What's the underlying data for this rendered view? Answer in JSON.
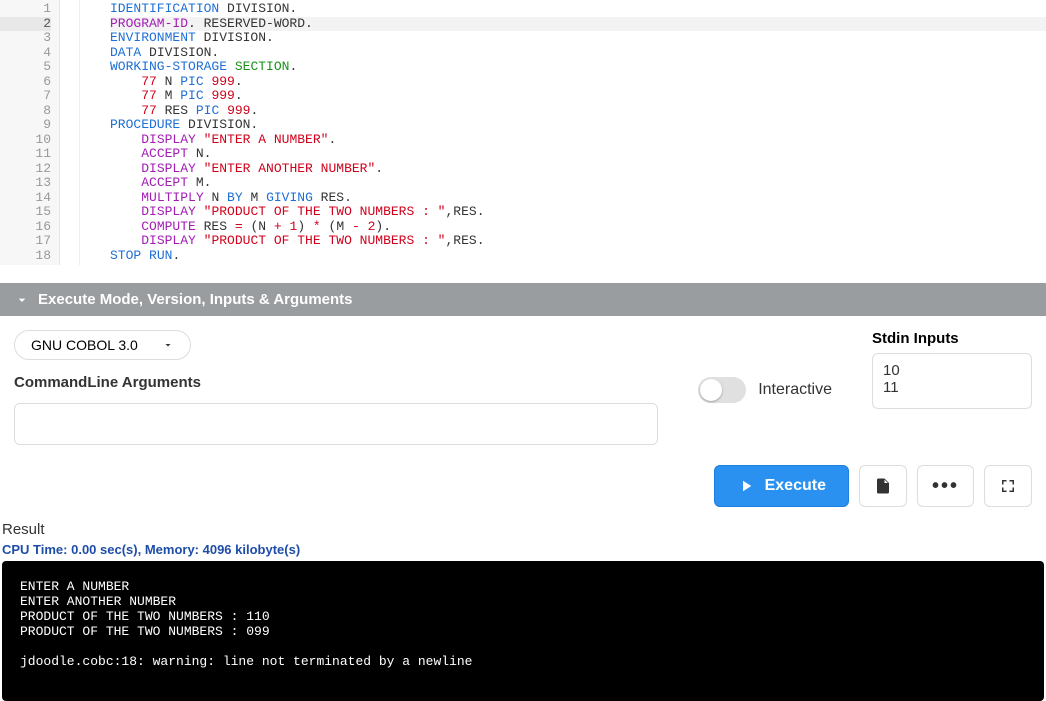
{
  "editor": {
    "active_line": 2,
    "line_count": 18,
    "tokens": [
      [
        {
          "t": "IDENTIFICATION",
          "c": "kw-blue"
        },
        {
          "t": " DIVISION.",
          "c": "plain"
        }
      ],
      [
        {
          "t": "PROGRAM-ID",
          "c": "kw-purple"
        },
        {
          "t": ". RESERVED-WORD.",
          "c": "plain"
        }
      ],
      [
        {
          "t": "ENVIRONMENT",
          "c": "kw-blue"
        },
        {
          "t": " DIVISION.",
          "c": "plain"
        }
      ],
      [
        {
          "t": "DATA",
          "c": "kw-blue"
        },
        {
          "t": " DIVISION.",
          "c": "plain"
        }
      ],
      [
        {
          "t": "WORKING-STORAGE",
          "c": "kw-blue"
        },
        {
          "t": " ",
          "c": "plain"
        },
        {
          "t": "SECTION",
          "c": "kw-green"
        },
        {
          "t": ".",
          "c": "plain"
        }
      ],
      [
        {
          "t": "    ",
          "c": "plain"
        },
        {
          "t": "77",
          "c": "num-red"
        },
        {
          "t": " N ",
          "c": "plain"
        },
        {
          "t": "PIC",
          "c": "kw-blue"
        },
        {
          "t": " ",
          "c": "plain"
        },
        {
          "t": "999",
          "c": "num-red"
        },
        {
          "t": ".",
          "c": "plain"
        }
      ],
      [
        {
          "t": "    ",
          "c": "plain"
        },
        {
          "t": "77",
          "c": "num-red"
        },
        {
          "t": " M ",
          "c": "plain"
        },
        {
          "t": "PIC",
          "c": "kw-blue"
        },
        {
          "t": " ",
          "c": "plain"
        },
        {
          "t": "999",
          "c": "num-red"
        },
        {
          "t": ".",
          "c": "plain"
        }
      ],
      [
        {
          "t": "    ",
          "c": "plain"
        },
        {
          "t": "77",
          "c": "num-red"
        },
        {
          "t": " RES ",
          "c": "plain"
        },
        {
          "t": "PIC",
          "c": "kw-blue"
        },
        {
          "t": " ",
          "c": "plain"
        },
        {
          "t": "999",
          "c": "num-red"
        },
        {
          "t": ".",
          "c": "plain"
        }
      ],
      [
        {
          "t": "PROCEDURE",
          "c": "kw-blue"
        },
        {
          "t": " DIVISION.",
          "c": "plain"
        }
      ],
      [
        {
          "t": "    ",
          "c": "plain"
        },
        {
          "t": "DISPLAY",
          "c": "kw-purple"
        },
        {
          "t": " ",
          "c": "plain"
        },
        {
          "t": "\"ENTER A NUMBER\"",
          "c": "str-red"
        },
        {
          "t": ".",
          "c": "plain"
        }
      ],
      [
        {
          "t": "    ",
          "c": "plain"
        },
        {
          "t": "ACCEPT",
          "c": "kw-purple"
        },
        {
          "t": " N.",
          "c": "plain"
        }
      ],
      [
        {
          "t": "    ",
          "c": "plain"
        },
        {
          "t": "DISPLAY",
          "c": "kw-purple"
        },
        {
          "t": " ",
          "c": "plain"
        },
        {
          "t": "\"ENTER ANOTHER NUMBER\"",
          "c": "str-red"
        },
        {
          "t": ".",
          "c": "plain"
        }
      ],
      [
        {
          "t": "    ",
          "c": "plain"
        },
        {
          "t": "ACCEPT",
          "c": "kw-purple"
        },
        {
          "t": " M.",
          "c": "plain"
        }
      ],
      [
        {
          "t": "    ",
          "c": "plain"
        },
        {
          "t": "MULTIPLY",
          "c": "kw-purple"
        },
        {
          "t": " N ",
          "c": "plain"
        },
        {
          "t": "BY",
          "c": "kw-blue"
        },
        {
          "t": " M ",
          "c": "plain"
        },
        {
          "t": "GIVING",
          "c": "kw-blue"
        },
        {
          "t": " RES.",
          "c": "plain"
        }
      ],
      [
        {
          "t": "    ",
          "c": "plain"
        },
        {
          "t": "DISPLAY",
          "c": "kw-purple"
        },
        {
          "t": " ",
          "c": "plain"
        },
        {
          "t": "\"PRODUCT OF THE TWO NUMBERS : \"",
          "c": "str-red"
        },
        {
          "t": ",RES.",
          "c": "plain"
        }
      ],
      [
        {
          "t": "    ",
          "c": "plain"
        },
        {
          "t": "COMPUTE",
          "c": "kw-purple"
        },
        {
          "t": " RES ",
          "c": "plain"
        },
        {
          "t": "=",
          "c": "op-red"
        },
        {
          "t": " (N ",
          "c": "plain"
        },
        {
          "t": "+",
          "c": "op-red"
        },
        {
          "t": " ",
          "c": "plain"
        },
        {
          "t": "1",
          "c": "num-red"
        },
        {
          "t": ") ",
          "c": "plain"
        },
        {
          "t": "*",
          "c": "op-red"
        },
        {
          "t": " (M ",
          "c": "plain"
        },
        {
          "t": "-",
          "c": "op-red"
        },
        {
          "t": " ",
          "c": "plain"
        },
        {
          "t": "2",
          "c": "num-red"
        },
        {
          "t": ").",
          "c": "plain"
        }
      ],
      [
        {
          "t": "    ",
          "c": "plain"
        },
        {
          "t": "DISPLAY",
          "c": "kw-purple"
        },
        {
          "t": " ",
          "c": "plain"
        },
        {
          "t": "\"PRODUCT OF THE TWO NUMBERS : \"",
          "c": "str-red"
        },
        {
          "t": ",RES.",
          "c": "plain"
        }
      ],
      [
        {
          "t": "STOP",
          "c": "kw-blue"
        },
        {
          "t": " ",
          "c": "plain"
        },
        {
          "t": "RUN",
          "c": "kw-blue"
        },
        {
          "t": ".",
          "c": "plain"
        }
      ]
    ]
  },
  "panel": {
    "title": "Execute Mode, Version, Inputs & Arguments",
    "version_select": "GNU COBOL 3.0",
    "interactive_label": "Interactive",
    "interactive_on": false,
    "cmdline_label": "CommandLine Arguments",
    "cmdline_value": "",
    "stdin_label": "Stdin Inputs",
    "stdin_value": "10\n11"
  },
  "buttons": {
    "execute": "Execute"
  },
  "result": {
    "label": "Result",
    "stats": "CPU Time: 0.00 sec(s), Memory: 4096 kilobyte(s)",
    "output": "ENTER A NUMBER\nENTER ANOTHER NUMBER\nPRODUCT OF THE TWO NUMBERS : 110\nPRODUCT OF THE TWO NUMBERS : 099\n\njdoodle.cobc:18: warning: line not terminated by a newline"
  }
}
